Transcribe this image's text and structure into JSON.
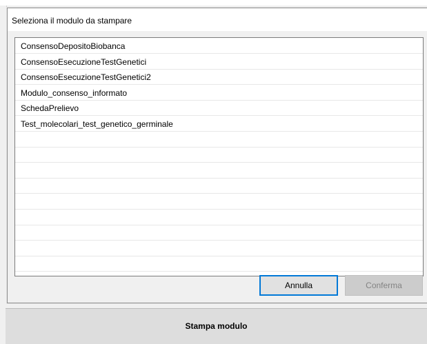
{
  "dialog": {
    "title": "Seleziona il modulo da stampare",
    "items": [
      "ConsensoDepositoBiobanca",
      "ConsensoEsecuzioneTestGenetici",
      "ConsensoEsecuzioneTestGenetici2",
      "Modulo_consenso_informato",
      "SchedaPrelievo",
      "Test_molecolari_test_genetico_germinale"
    ],
    "cancel_label": "Annulla",
    "confirm_label": "Conferma"
  },
  "main": {
    "print_button_label": "Stampa modulo"
  },
  "colors": {
    "accent": "#0078d7",
    "disabled_text": "#838383"
  }
}
